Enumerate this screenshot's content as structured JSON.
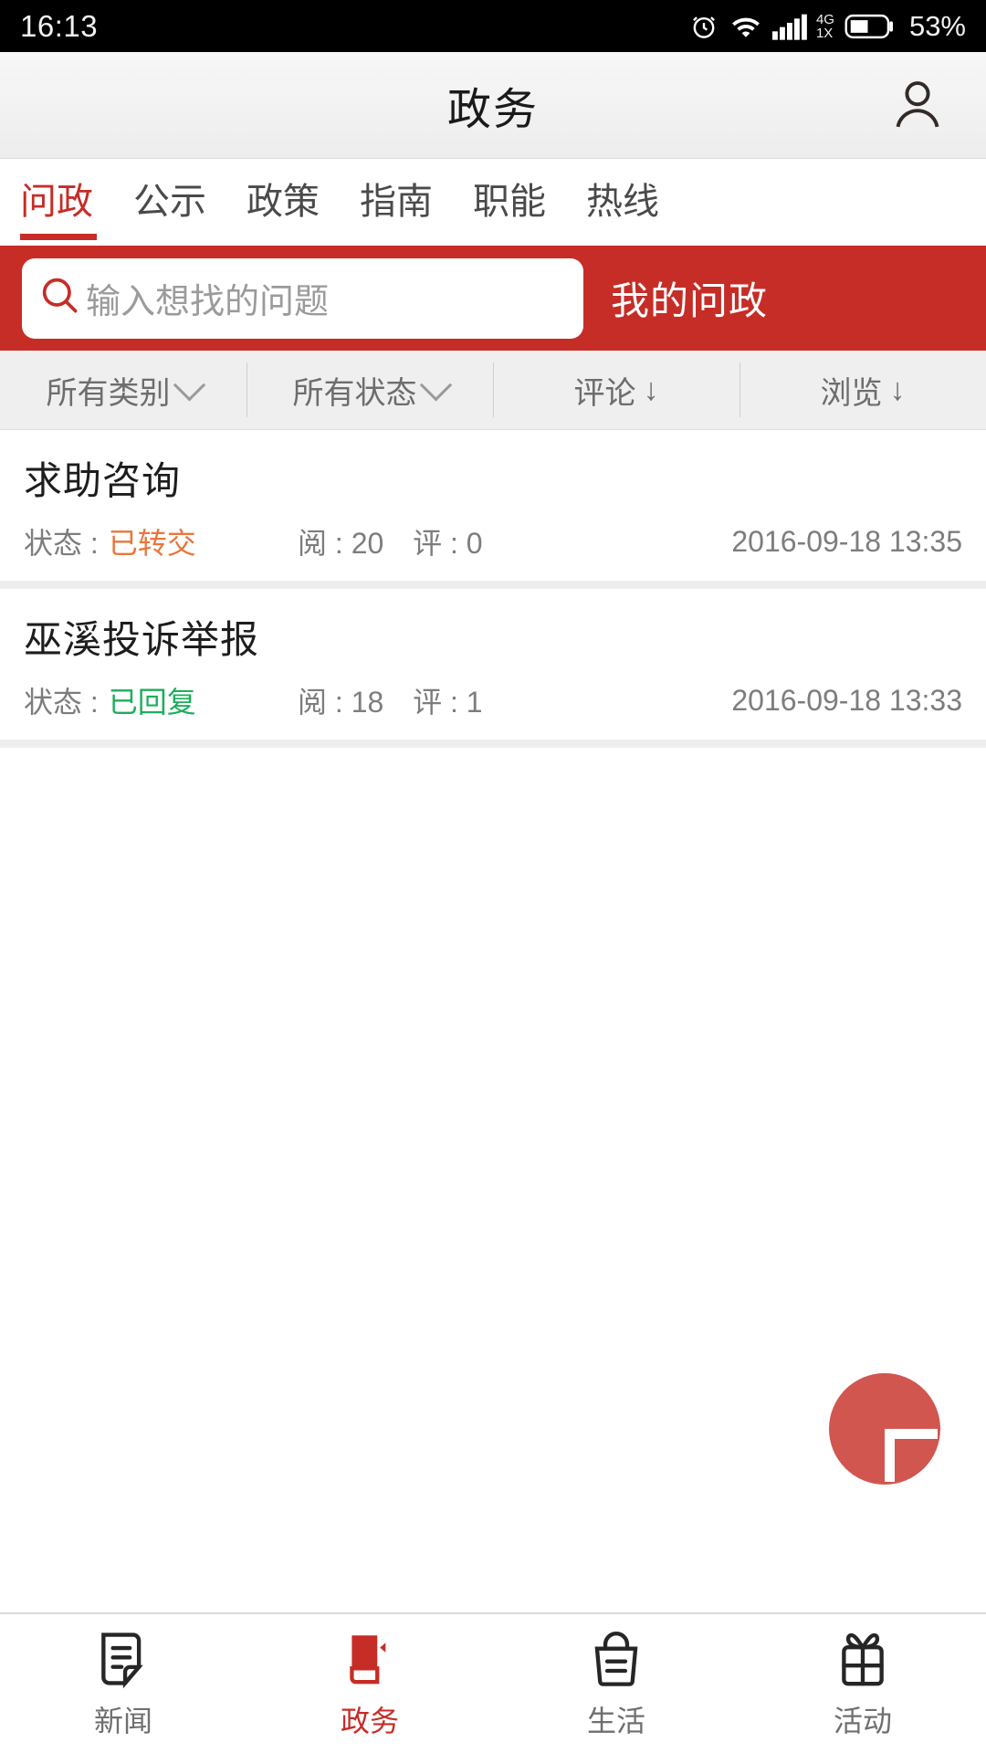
{
  "status_bar": {
    "time": "16:13",
    "network_primary": "4G",
    "network_secondary": "1X",
    "battery_percent": "53%",
    "icons": [
      "alarm-icon",
      "wifi-icon",
      "signal-icon",
      "battery-icon"
    ]
  },
  "header": {
    "title": "政务",
    "profile_icon": "person-icon"
  },
  "tabs": [
    {
      "label": "问政",
      "active": true
    },
    {
      "label": "公示",
      "active": false
    },
    {
      "label": "政策",
      "active": false
    },
    {
      "label": "指南",
      "active": false
    },
    {
      "label": "职能",
      "active": false
    },
    {
      "label": "热线",
      "active": false
    }
  ],
  "search": {
    "placeholder": "输入想找的问题",
    "value": "",
    "icon": "search-icon",
    "action_label": "我的问政",
    "band_color": "#c62d27"
  },
  "filters": [
    {
      "label": "所有类别",
      "indicator": "chevron-down-icon"
    },
    {
      "label": "所有状态",
      "indicator": "chevron-down-icon"
    },
    {
      "label": "评论",
      "indicator": "arrow-down-icon",
      "arrow": "↓"
    },
    {
      "label": "浏览",
      "indicator": "arrow-down-icon",
      "arrow": "↓"
    }
  ],
  "list": {
    "status_label": "状态 :",
    "views_label": "阅 :",
    "comments_label": "评 :",
    "items": [
      {
        "title": "求助咨询",
        "status": "已转交",
        "status_color": "#e8763c",
        "views": "20",
        "comments": "0",
        "datetime": "2016-09-18 13:35"
      },
      {
        "title": "巫溪投诉举报",
        "status": "已回复",
        "status_color": "#1eae5c",
        "views": "18",
        "comments": "1",
        "datetime": "2016-09-18 13:33"
      }
    ]
  },
  "fab": {
    "icon": "plus-icon",
    "color": "#d15650"
  },
  "bottom_nav": [
    {
      "label": "新闻",
      "icon": "news-document-icon",
      "active": false
    },
    {
      "label": "政务",
      "icon": "government-book-icon",
      "active": true
    },
    {
      "label": "生活",
      "icon": "basket-icon",
      "active": false
    },
    {
      "label": "活动",
      "icon": "gift-icon",
      "active": false
    }
  ],
  "theme": {
    "accent_red": "#c62d27",
    "filter_bg": "#efefef",
    "divider": "#eeeeee"
  }
}
